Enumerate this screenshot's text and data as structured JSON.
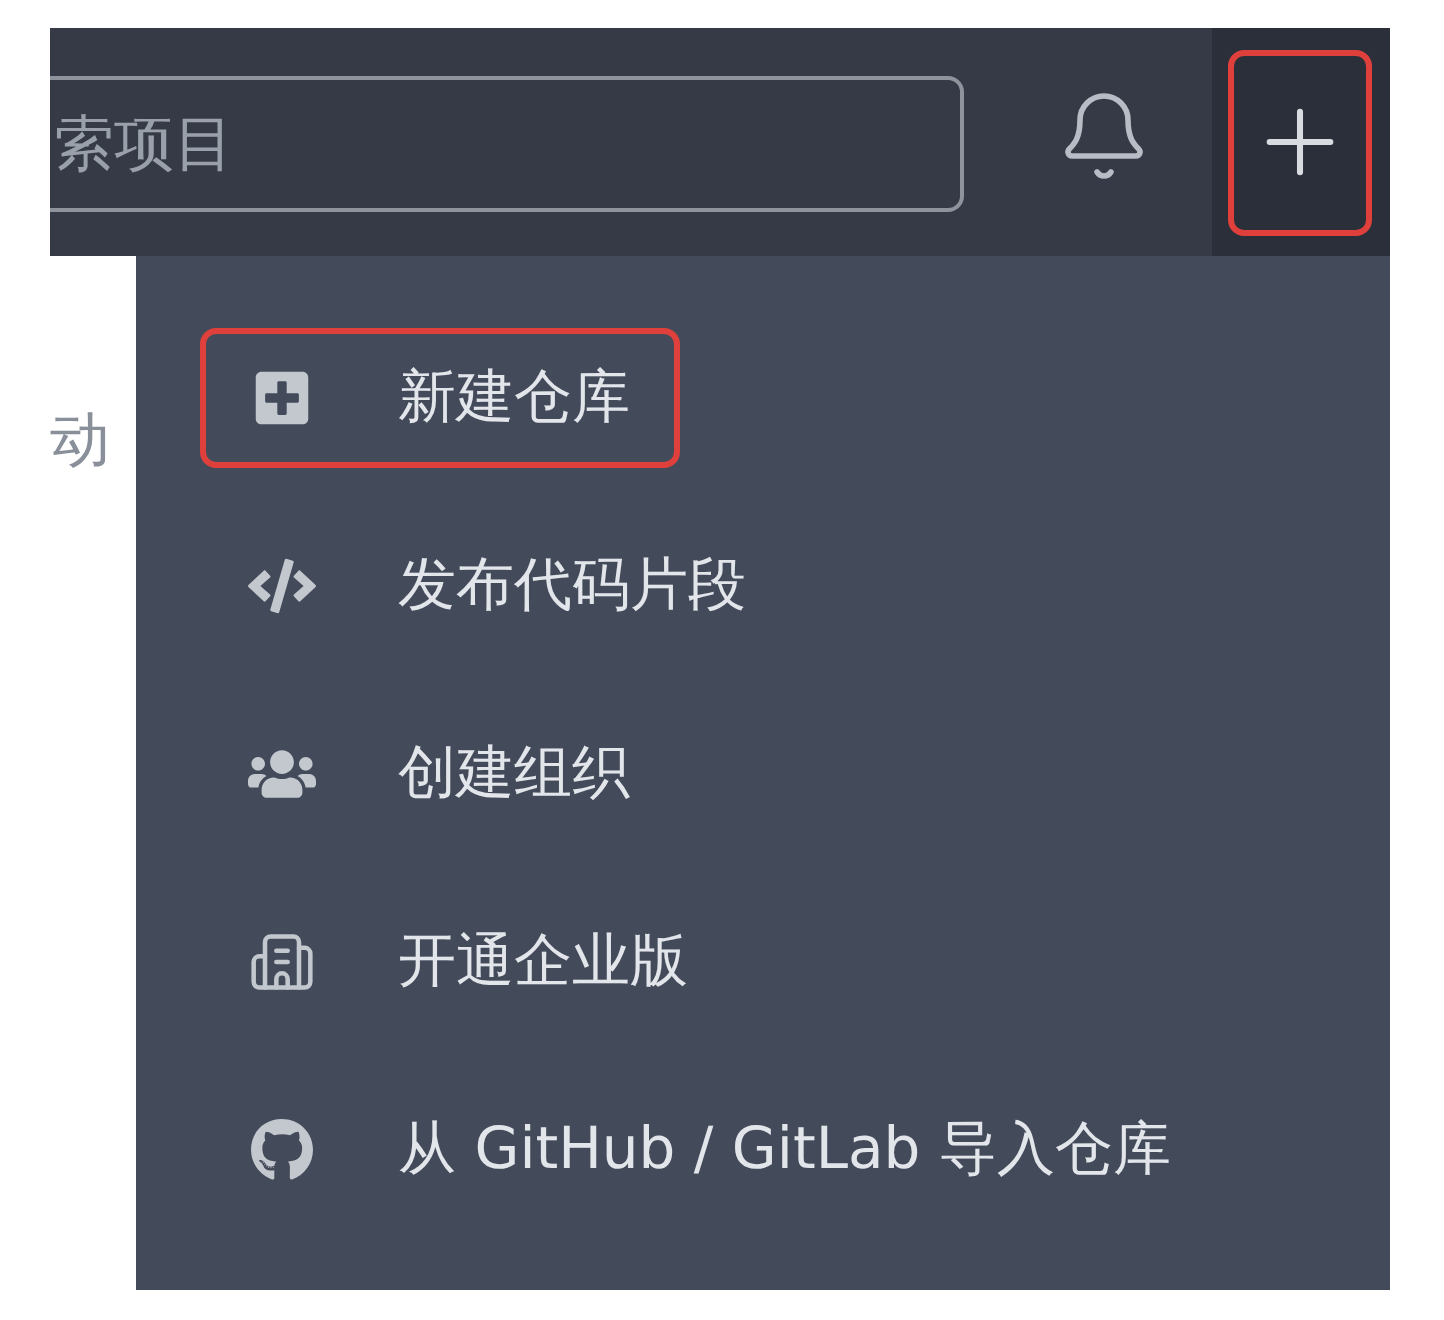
{
  "top_bar": {
    "search": {
      "placeholder": "索项目"
    },
    "add_button": {
      "highlighted": true
    }
  },
  "page": {
    "tab_label": "动"
  },
  "dropdown_menu": {
    "items": [
      {
        "label": "新建仓库",
        "highlighted": true
      },
      {
        "label": "发布代码片段",
        "highlighted": false
      },
      {
        "label": "创建组织",
        "highlighted": false
      },
      {
        "label": "开通企业版",
        "highlighted": false
      },
      {
        "label": "从 GitHub / GitLab 导入仓库",
        "highlighted": false
      }
    ]
  }
}
